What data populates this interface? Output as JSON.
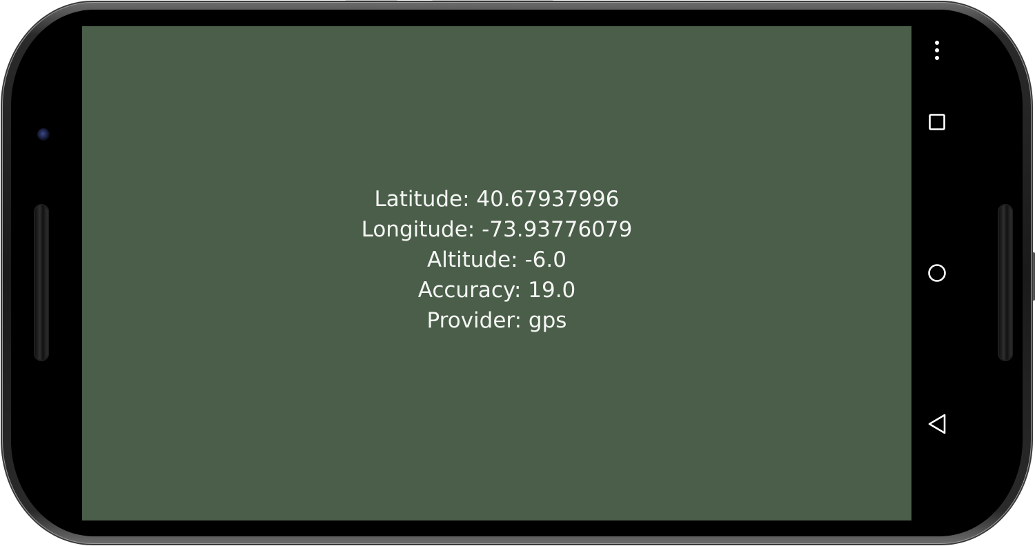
{
  "device": {
    "frame": "Nexus 6",
    "orientation": "landscape"
  },
  "colors": {
    "app_background": "#4a5e4a",
    "text": "#f4f6f3",
    "nav_bar": "#000000",
    "nav_icon": "#ffffff"
  },
  "location_info": {
    "latitude": "Latitude: 40.67937996",
    "longitude": "Longitude: -73.93776079",
    "altitude": "Altitude: -6.0",
    "accuracy": "Accuracy: 19.0",
    "provider": "Provider: gps"
  },
  "navigation_bar": {
    "items": [
      {
        "name": "overflow-menu",
        "icon": "more-vert-icon"
      },
      {
        "name": "recents",
        "icon": "square-icon"
      },
      {
        "name": "home",
        "icon": "circle-icon"
      },
      {
        "name": "back",
        "icon": "triangle-back-icon"
      }
    ]
  }
}
